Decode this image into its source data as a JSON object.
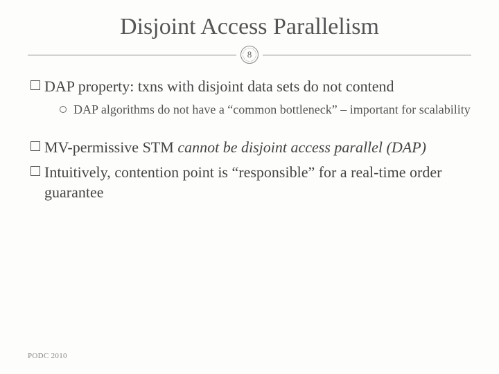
{
  "title": "Disjoint Access Parallelism",
  "page_number": "8",
  "bullets": {
    "b1_pre": "DAP property: txns with disjoint data sets do not contend",
    "b1_sub": "DAP algorithms do not have a “common bottleneck” – important for scalability",
    "b2_plain": "MV-permissive STM ",
    "b2_italic": "cannot be disjoint access parallel (DAP)",
    "b3": "Intuitively, contention point is “responsible” for a real-time order guarantee"
  },
  "footer": "PODC 2010"
}
